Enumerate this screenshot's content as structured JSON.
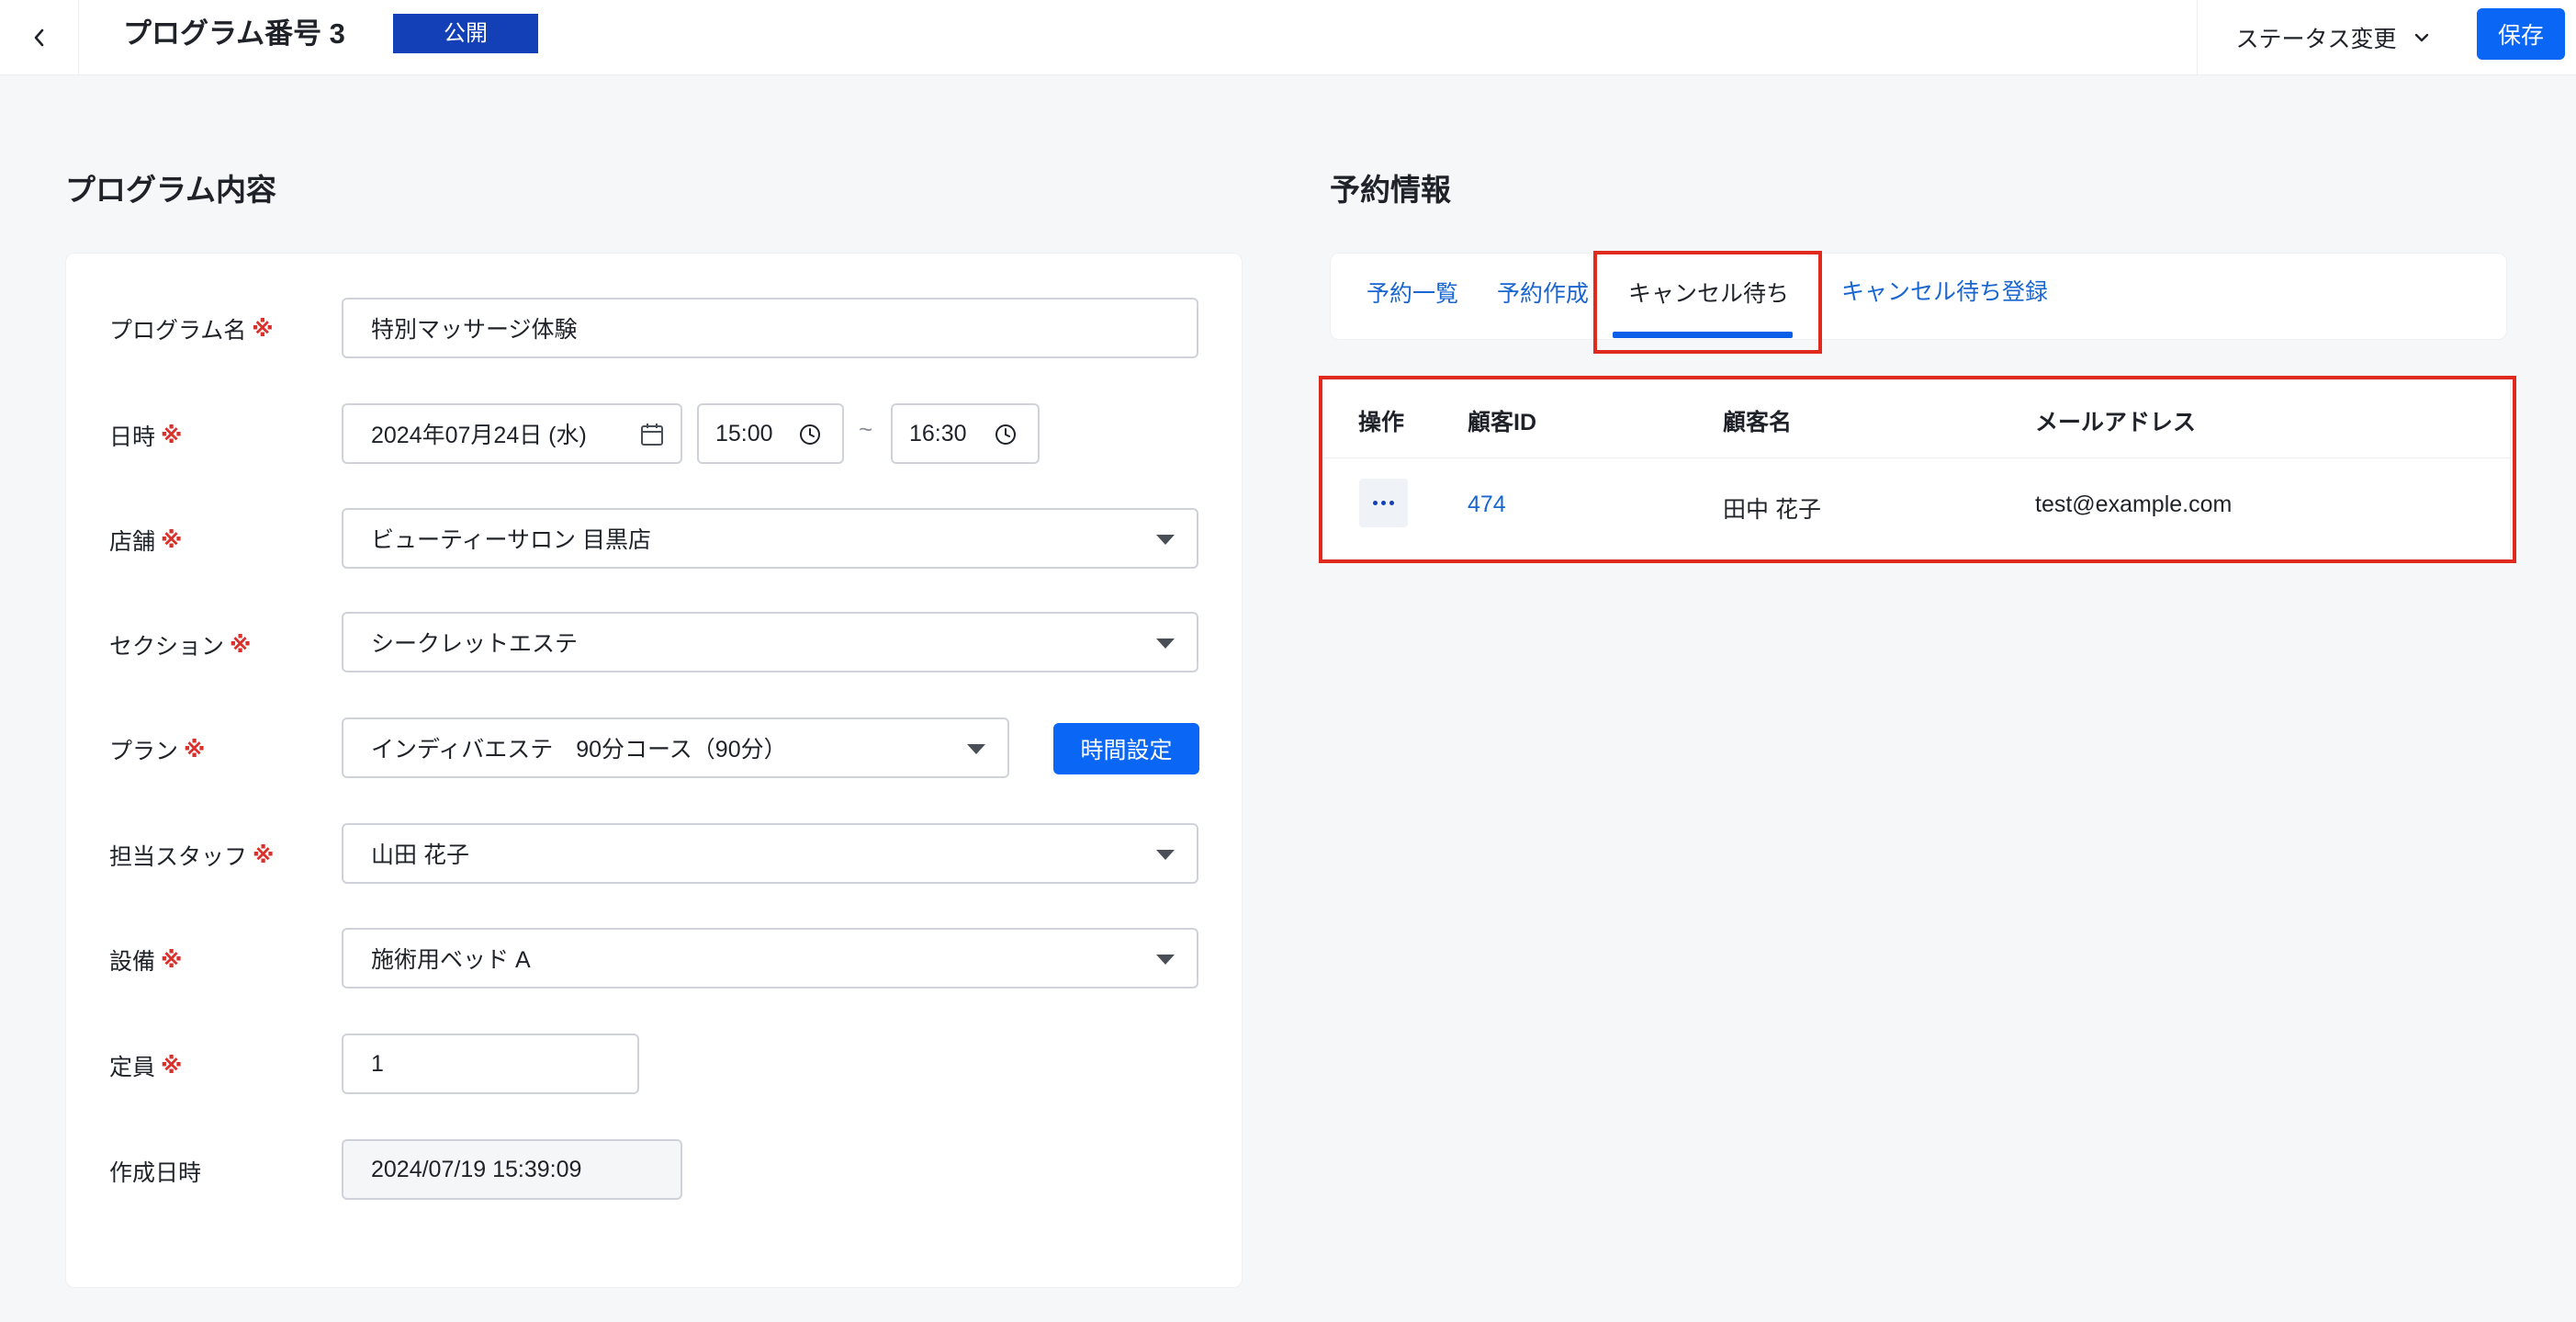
{
  "header": {
    "title": "プログラム番号 3",
    "status_badge": "公開",
    "status_change_label": "ステータス変更",
    "save_label": "保存"
  },
  "program": {
    "section_title": "プログラム内容",
    "required_mark": "※",
    "fields": {
      "name": {
        "label": "プログラム名",
        "value": "特別マッサージ体験"
      },
      "datetime": {
        "label": "日時",
        "date": "2024年07月24日 (水)",
        "start_time": "15:00",
        "end_time": "16:30",
        "separator": "~"
      },
      "store": {
        "label": "店舗",
        "value": "ビューティーサロン 目黒店"
      },
      "section": {
        "label": "セクション",
        "value": "シークレットエステ"
      },
      "plan": {
        "label": "プラン",
        "value": "インディバエステ　90分コース（90分）",
        "time_setting_label": "時間設定"
      },
      "staff": {
        "label": "担当スタッフ",
        "value": "山田 花子"
      },
      "equipment": {
        "label": "設備",
        "value": "施術用ベッド A"
      },
      "capacity": {
        "label": "定員",
        "value": "1"
      },
      "created_at": {
        "label": "作成日時",
        "value": "2024/07/19 15:39:09"
      }
    }
  },
  "reservation": {
    "section_title": "予約情報",
    "tabs": [
      {
        "label": "予約一覧",
        "active": false
      },
      {
        "label": "予約作成",
        "active": false
      },
      {
        "label": "キャンセル待ち",
        "active": true
      },
      {
        "label": "キャンセル待ち登録",
        "active": false
      }
    ],
    "table": {
      "headers": [
        "操作",
        "顧客ID",
        "顧客名",
        "メールアドレス"
      ],
      "rows": [
        {
          "customer_id": "474",
          "customer_name": "田中 花子",
          "email": "test@example.com"
        }
      ]
    }
  },
  "colors": {
    "primary": "#0a66f5",
    "badge": "#1340b7",
    "link": "#1a66d1",
    "required": "#d9302b",
    "highlight": "#df2a1d"
  }
}
